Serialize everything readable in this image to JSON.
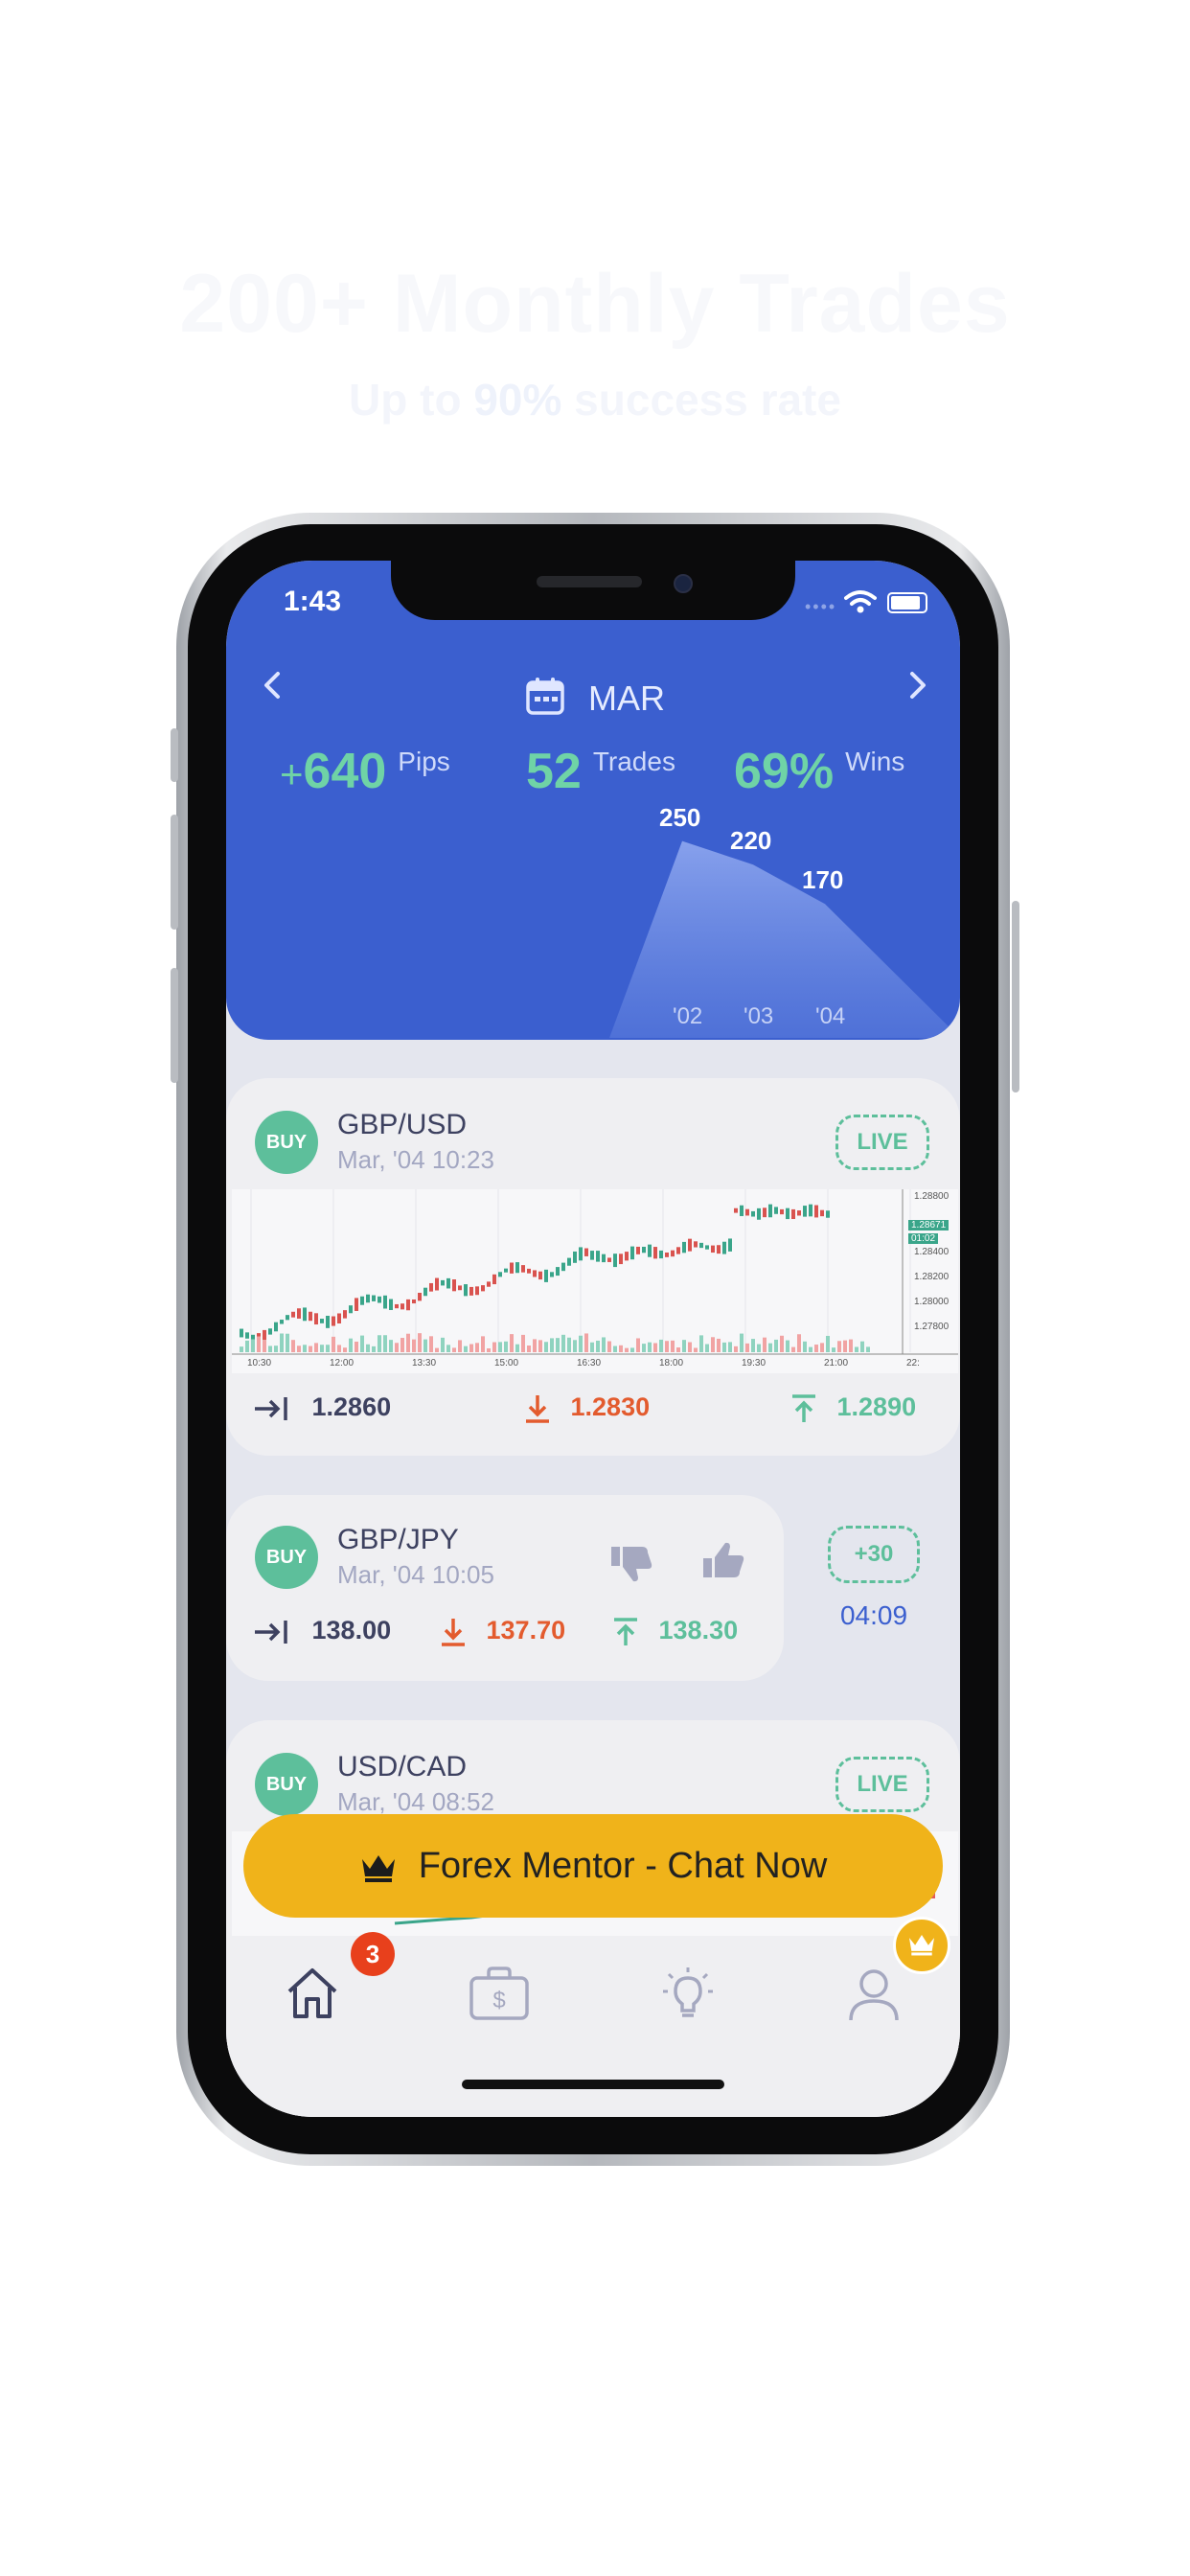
{
  "marketing": {
    "headline": "200+ Monthly Trades",
    "sub_prefix": "Up to ",
    "sub_highlight": "90%",
    "sub_suffix": " success rate"
  },
  "status_bar": {
    "time": "1:43"
  },
  "header": {
    "month": "MAR",
    "prev_icon": "chevron-left-icon",
    "next_icon": "chevron-right-icon",
    "calendar_icon": "calendar-icon",
    "stats": {
      "pips_sign": "+",
      "pips_value": "640",
      "pips_unit": "Pips",
      "trades_value": "52",
      "trades_unit": "Trades",
      "wins_value": "69%",
      "wins_unit": "Wins"
    }
  },
  "chart_data": {
    "type": "area",
    "categories": [
      "'02",
      "'03",
      "'04"
    ],
    "values": [
      250,
      220,
      170
    ],
    "title": "",
    "xlabel": "",
    "ylabel": ""
  },
  "cards": [
    {
      "side": "BUY",
      "pair": "GBP/USD",
      "time": "Mar, '04 10:23",
      "status": "LIVE",
      "entry": "1.2860",
      "stop_loss": "1.2830",
      "take_profit": "1.2890",
      "x_ticks": [
        "10:30",
        "12:00",
        "13:30",
        "15:00",
        "16:30",
        "18:00",
        "19:30",
        "21:00",
        "22:"
      ],
      "y_ticks": [
        "1.28800",
        "1.28400",
        "1.28200",
        "1.28000",
        "1.27800"
      ],
      "price_tag": "1.28671",
      "time_tag": "01:02"
    },
    {
      "side": "BUY",
      "pair": "GBP/JPY",
      "time": "Mar, '04 10:05",
      "result": "+30",
      "duration": "04:09",
      "entry": "138.00",
      "stop_loss": "137.70",
      "take_profit": "138.30"
    },
    {
      "side": "BUY",
      "pair": "USD/CAD",
      "time": "Mar, '04 08:52",
      "status": "LIVE"
    }
  ],
  "cta": {
    "label": "Forex Mentor - Chat Now",
    "icon": "crown-icon"
  },
  "tabbar": {
    "items": [
      "home-icon",
      "briefcase-dollar-icon",
      "lightbulb-icon",
      "user-icon"
    ],
    "badge": "3"
  },
  "colors": {
    "header": "#3b5fcf",
    "accent_green": "#5dbf9b",
    "stop_red": "#e35b2e",
    "cta_yellow": "#f0b31a",
    "badge_red": "#e8401c"
  }
}
